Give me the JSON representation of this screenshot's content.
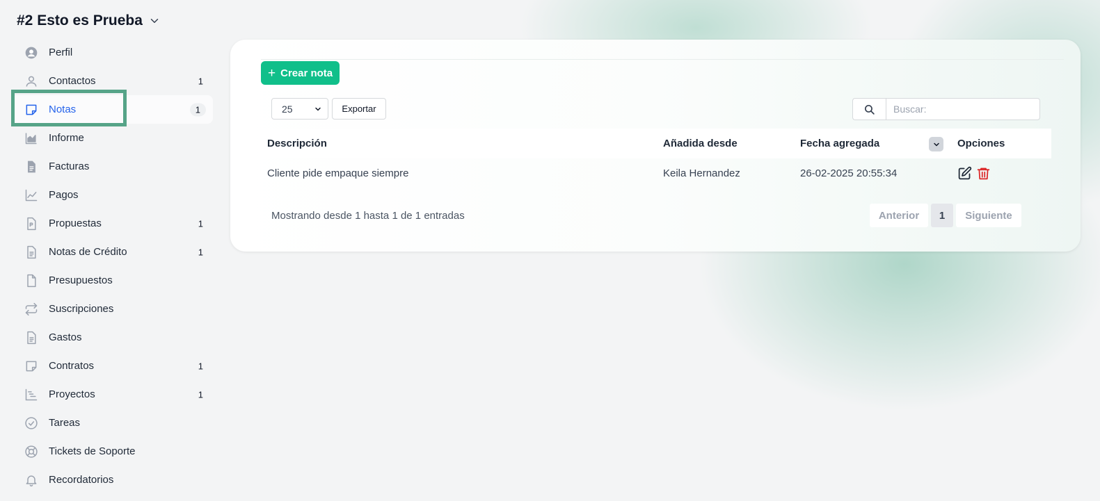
{
  "project": {
    "title": "#2 Esto es Prueba"
  },
  "sidebar": {
    "items": [
      {
        "label": "Perfil",
        "icon": "user-circle-icon",
        "count": ""
      },
      {
        "label": "Contactos",
        "icon": "user-icon",
        "count": "1"
      },
      {
        "label": "Notas",
        "icon": "note-icon",
        "count": "1",
        "active": true
      },
      {
        "label": "Informe",
        "icon": "area-chart-icon",
        "count": ""
      },
      {
        "label": "Facturas",
        "icon": "invoice-icon",
        "count": ""
      },
      {
        "label": "Pagos",
        "icon": "line-chart-icon",
        "count": ""
      },
      {
        "label": "Propuestas",
        "icon": "proposal-icon",
        "count": "1"
      },
      {
        "label": "Notas de Crédito",
        "icon": "credit-note-icon",
        "count": "1"
      },
      {
        "label": "Presupuestos",
        "icon": "file-icon",
        "count": ""
      },
      {
        "label": "Suscripciones",
        "icon": "repeat-icon",
        "count": ""
      },
      {
        "label": "Gastos",
        "icon": "document-icon",
        "count": ""
      },
      {
        "label": "Contratos",
        "icon": "contract-icon",
        "count": "1"
      },
      {
        "label": "Proyectos",
        "icon": "gantt-icon",
        "count": "1"
      },
      {
        "label": "Tareas",
        "icon": "check-circle-icon",
        "count": ""
      },
      {
        "label": "Tickets de Soporte",
        "icon": "lifebuoy-icon",
        "count": ""
      },
      {
        "label": "Recordatorios",
        "icon": "bell-icon",
        "count": ""
      }
    ]
  },
  "toolbar": {
    "create_label": "Crear nota",
    "page_size": "25",
    "export_label": "Exportar",
    "search_placeholder": "Buscar:"
  },
  "table": {
    "headers": {
      "description": "Descripción",
      "added_from": "Añadida desde",
      "date_added": "Fecha agregada",
      "options": "Opciones"
    },
    "rows": [
      {
        "description": "Cliente pide empaque siempre",
        "added_from": "Keila Hernandez",
        "date_added": "26-02-2025 20:55:34"
      }
    ]
  },
  "footer": {
    "info": "Mostrando desde 1 hasta 1 de 1 entradas",
    "prev": "Anterior",
    "page": "1",
    "next": "Siguiente"
  },
  "colors": {
    "accent": "#10bf8a",
    "active_link": "#2563eb",
    "delete": "#dc2626",
    "highlight": "#56a488"
  }
}
